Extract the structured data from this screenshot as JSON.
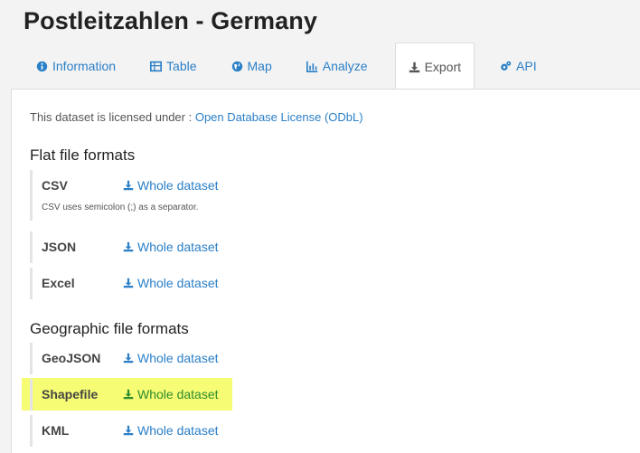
{
  "page": {
    "title": "Postleitzahlen - Germany"
  },
  "tabs": [
    {
      "label": "Information",
      "icon": "info-circle-icon"
    },
    {
      "label": "Table",
      "icon": "table-icon"
    },
    {
      "label": "Map",
      "icon": "globe-icon"
    },
    {
      "label": "Analyze",
      "icon": "bar-chart-icon"
    },
    {
      "label": "Export",
      "icon": "download-icon",
      "active": true
    },
    {
      "label": "API",
      "icon": "gears-icon"
    }
  ],
  "license": {
    "prefix": "This dataset is licensed under :",
    "link": "Open Database License (ODbL)"
  },
  "flat": {
    "title": "Flat file formats",
    "rows": [
      {
        "format": "CSV",
        "link": "Whole dataset",
        "note": "CSV uses semicolon (;) as a separator."
      },
      {
        "format": "JSON",
        "link": "Whole dataset"
      },
      {
        "format": "Excel",
        "link": "Whole dataset"
      }
    ]
  },
  "geo": {
    "title": "Geographic file formats",
    "rows": [
      {
        "format": "GeoJSON",
        "link": "Whole dataset"
      },
      {
        "format": "Shapefile",
        "link": "Whole dataset",
        "highlighted": true
      },
      {
        "format": "KML",
        "link": "Whole dataset"
      }
    ]
  },
  "colors": {
    "link": "#2a7fc7",
    "highlight": "#f4fc5a",
    "highlight_link": "#2e8b2e"
  }
}
